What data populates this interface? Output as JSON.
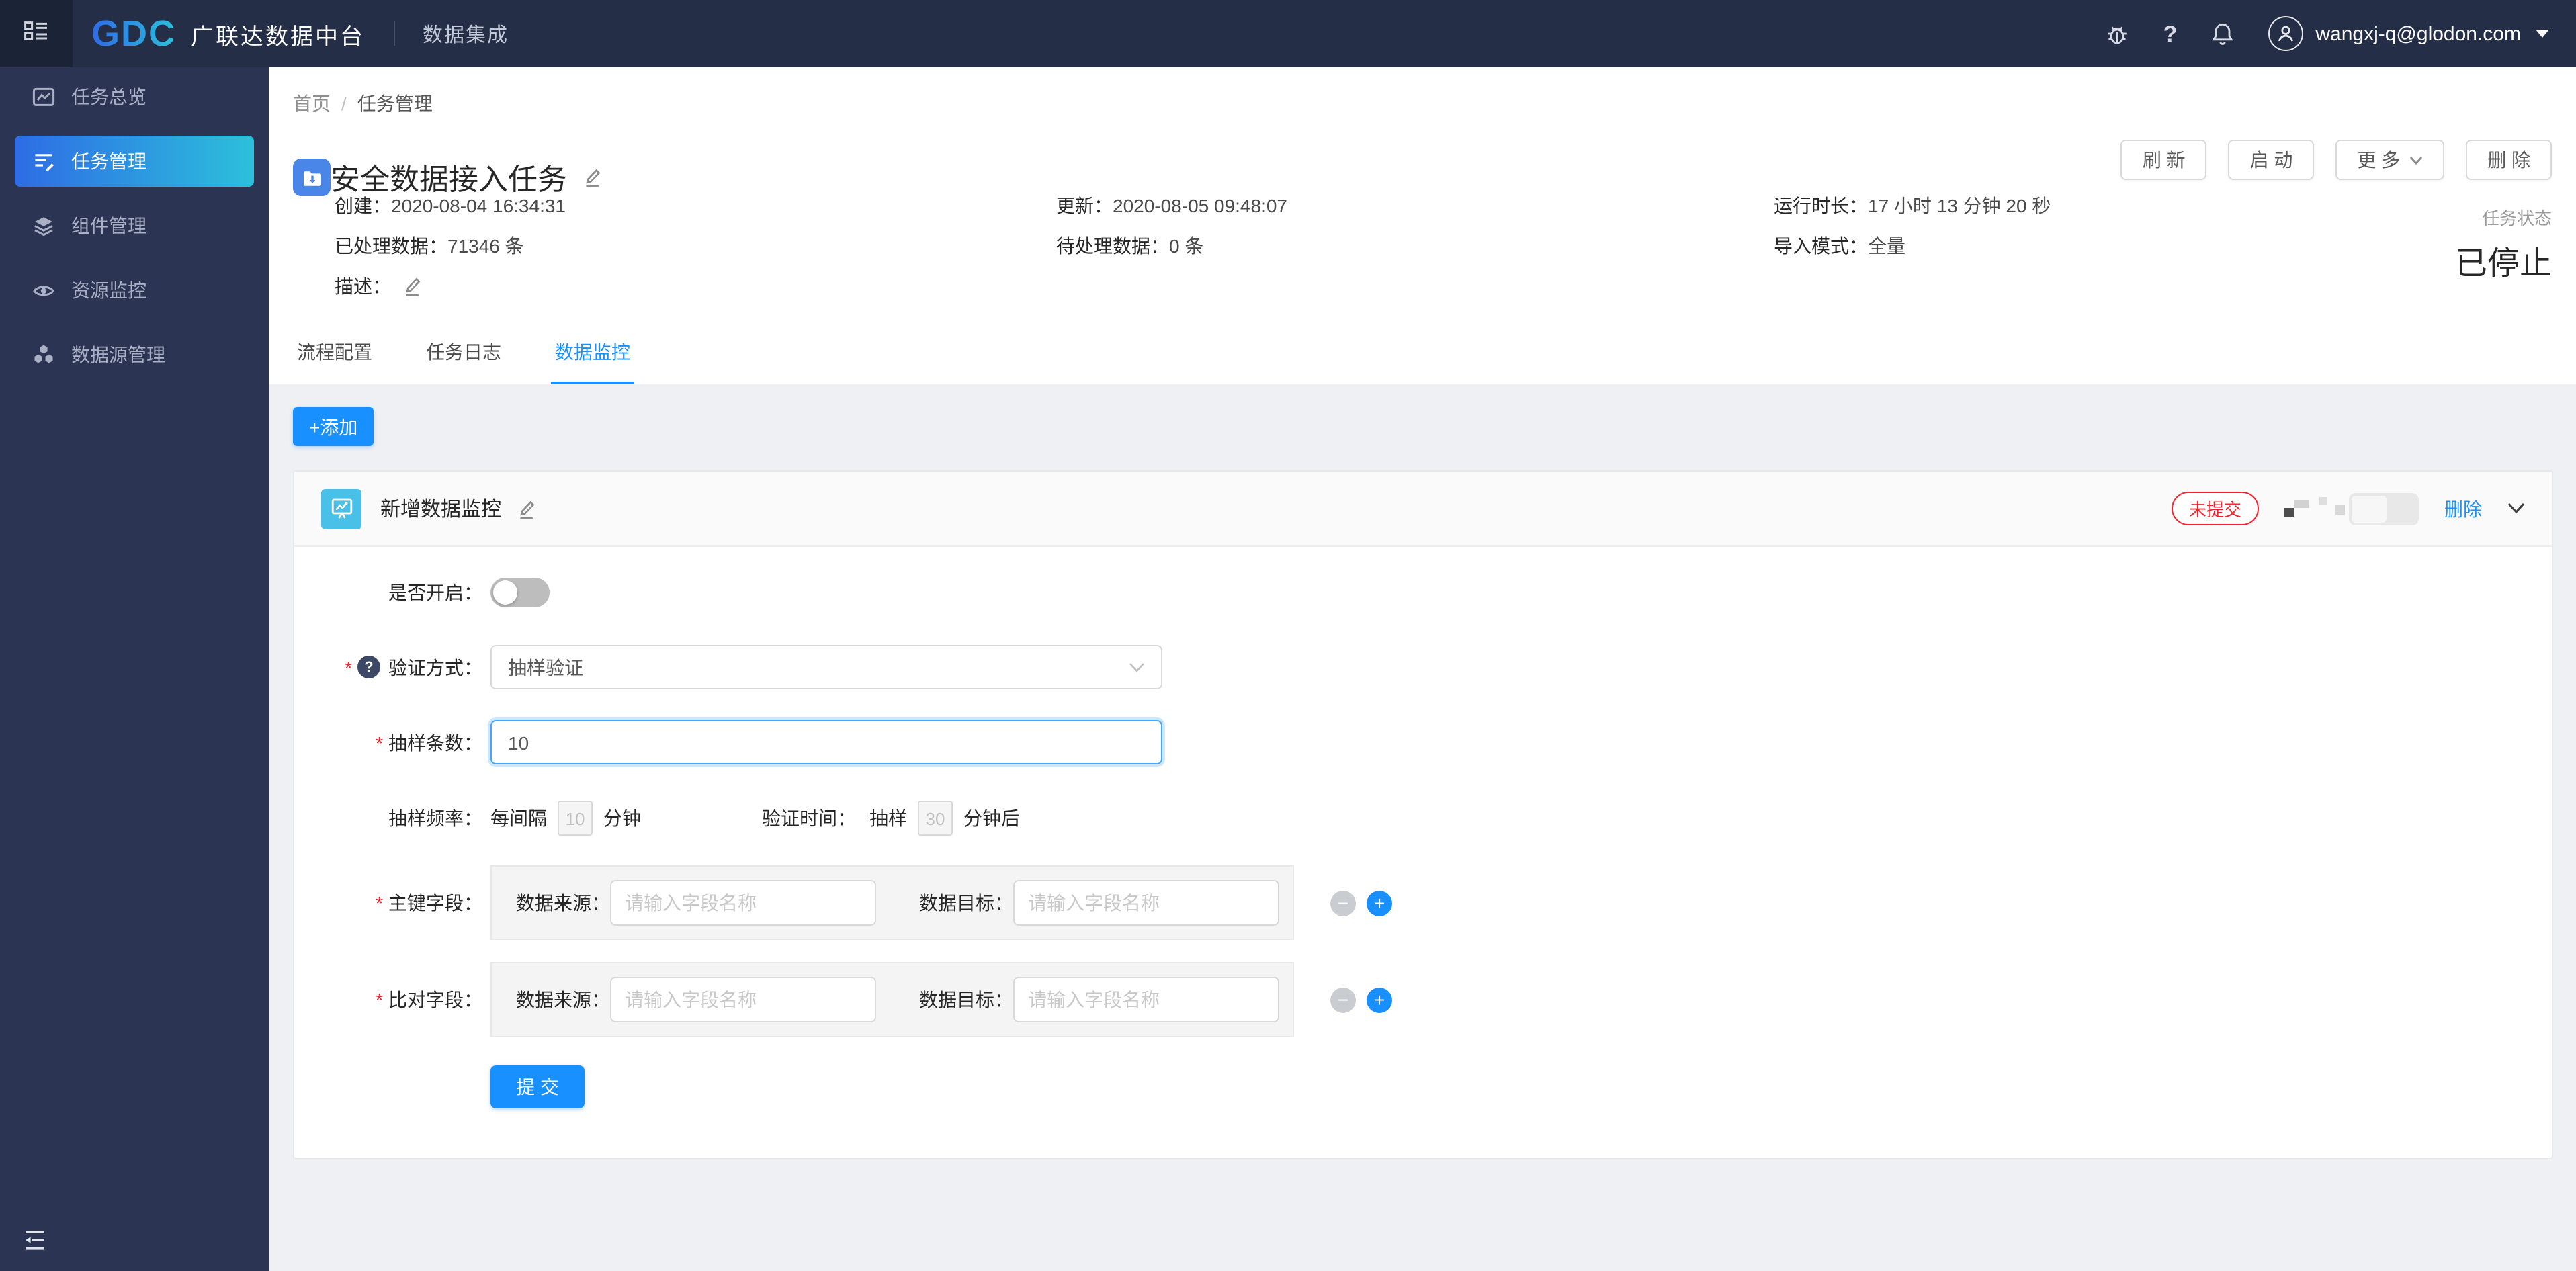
{
  "topbar": {
    "logo": "GDC",
    "product": "广联达数据中台",
    "app": "数据集成",
    "user_email": "wangxj-q@glodon.com"
  },
  "sidebar": {
    "items": [
      {
        "label": "任务总览"
      },
      {
        "label": "任务管理"
      },
      {
        "label": "组件管理"
      },
      {
        "label": "资源监控"
      },
      {
        "label": "数据源管理"
      }
    ]
  },
  "breadcrumb": {
    "home": "首页",
    "sep": "/",
    "current": "任务管理"
  },
  "task": {
    "title": "安全数据接入任务",
    "created_label": "创建：",
    "created": "2020-08-04 16:34:31",
    "updated_label": "更新：",
    "updated": "2020-08-05 09:48:07",
    "runtime_label": "运行时长：",
    "runtime": "17 小时 13 分钟 20 秒",
    "processed_label": "已处理数据：",
    "processed": "71346 条",
    "pending_label": "待处理数据：",
    "pending": "0 条",
    "import_label": "导入模式：",
    "import_mode": "全量",
    "desc_label": "描述：",
    "status_label": "任务状态",
    "status": "已停止"
  },
  "actions": {
    "refresh": "刷 新",
    "start": "启 动",
    "more": "更 多",
    "delete": "删 除"
  },
  "tabs": [
    {
      "label": "流程配置"
    },
    {
      "label": "任务日志"
    },
    {
      "label": "数据监控"
    }
  ],
  "monitor": {
    "add": "+添加",
    "panel_title": "新增数据监控",
    "badge": "未提交",
    "delete": "删除",
    "form": {
      "required_mark": "*",
      "help_mark": "?",
      "enable_label": "是否开启：",
      "verify_label": "验证方式：",
      "verify_value": "抽样验证",
      "count_label": "抽样条数：",
      "count_value": "10",
      "freq_label": "抽样频率：",
      "freq_prefix": "每间隔",
      "freq_value": "10",
      "freq_suffix": "分钟",
      "time_label": "验证时间：",
      "time_prefix": "抽样",
      "time_value": "30",
      "time_suffix": "分钟后",
      "primary_label": "主键字段：",
      "compare_label": "比对字段：",
      "source_label": "数据来源：",
      "target_label": "数据目标：",
      "field_placeholder": "请输入字段名称",
      "submit": "提 交"
    }
  },
  "colors": {
    "accent": "#1890ff",
    "danger": "#f5222d",
    "active_gradient_start": "#2e6ce5",
    "active_gradient_end": "#2cc0db"
  }
}
